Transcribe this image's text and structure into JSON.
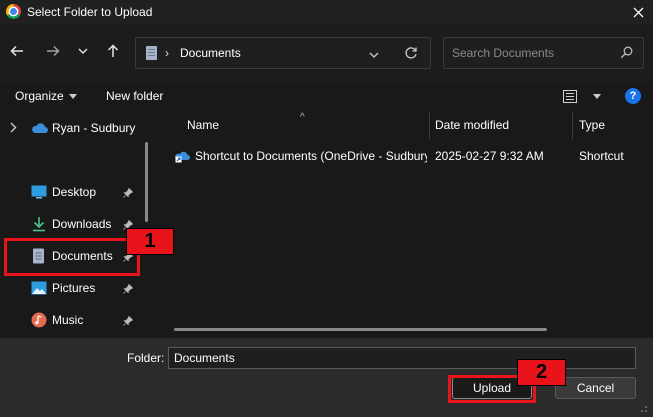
{
  "window": {
    "title": "Select Folder to Upload"
  },
  "address": {
    "path": "Documents"
  },
  "search": {
    "placeholder": "Search Documents"
  },
  "toolbar": {
    "organize_label": "Organize",
    "new_folder_label": "New folder"
  },
  "sidebar": {
    "items": [
      {
        "label": "Ryan - Sudbury",
        "icon": "onedrive-cloud-icon"
      },
      {
        "label": "Desktop",
        "icon": "desktop-icon",
        "pinned": true
      },
      {
        "label": "Downloads",
        "icon": "download-arrow-icon",
        "pinned": true
      },
      {
        "label": "Documents",
        "icon": "documents-icon",
        "pinned": true,
        "selected": true
      },
      {
        "label": "Pictures",
        "icon": "pictures-icon",
        "pinned": true
      },
      {
        "label": "Music",
        "icon": "music-icon",
        "pinned": true
      }
    ]
  },
  "columns": {
    "name": "Name",
    "date_modified": "Date modified",
    "type": "Type"
  },
  "files": [
    {
      "name": "Shortcut to Documents (OneDrive - Sudbury)",
      "date_modified": "2025-02-27 9:32 AM",
      "type": "Shortcut"
    }
  ],
  "footer": {
    "folder_label": "Folder:",
    "folder_value": "Documents",
    "upload_label": "Upload",
    "cancel_label": "Cancel"
  },
  "annotations": {
    "step1": "1",
    "step2": "2"
  },
  "colors": {
    "highlight": "#e8131b",
    "accent": "#1a73e8",
    "background": "#191919"
  }
}
